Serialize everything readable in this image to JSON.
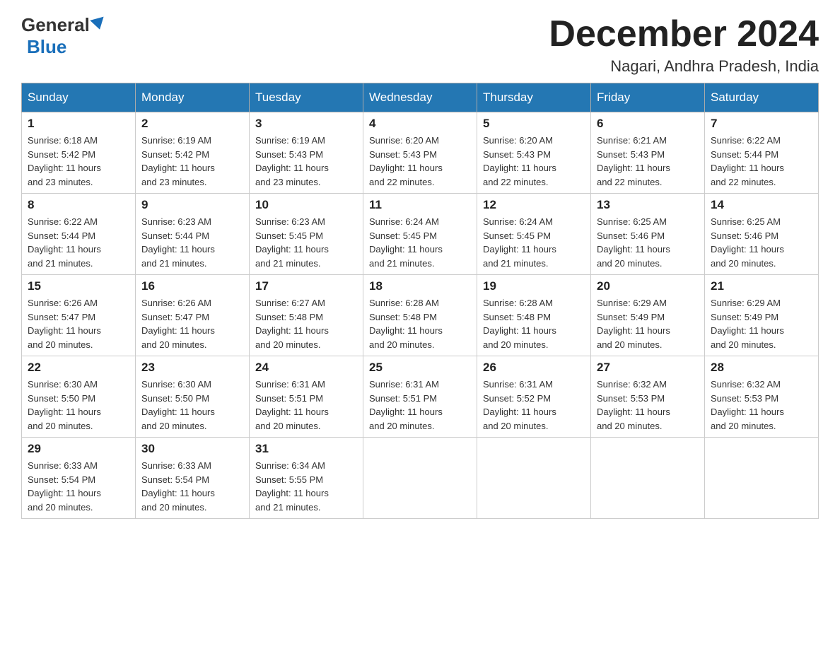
{
  "logo": {
    "general": "General",
    "triangle": "▲",
    "blue": "Blue"
  },
  "title": "December 2024",
  "location": "Nagari, Andhra Pradesh, India",
  "weekdays": [
    "Sunday",
    "Monday",
    "Tuesday",
    "Wednesday",
    "Thursday",
    "Friday",
    "Saturday"
  ],
  "weeks": [
    [
      {
        "day": "1",
        "sunrise": "6:18 AM",
        "sunset": "5:42 PM",
        "daylight": "11 hours and 23 minutes."
      },
      {
        "day": "2",
        "sunrise": "6:19 AM",
        "sunset": "5:42 PM",
        "daylight": "11 hours and 23 minutes."
      },
      {
        "day": "3",
        "sunrise": "6:19 AM",
        "sunset": "5:43 PM",
        "daylight": "11 hours and 23 minutes."
      },
      {
        "day": "4",
        "sunrise": "6:20 AM",
        "sunset": "5:43 PM",
        "daylight": "11 hours and 22 minutes."
      },
      {
        "day": "5",
        "sunrise": "6:20 AM",
        "sunset": "5:43 PM",
        "daylight": "11 hours and 22 minutes."
      },
      {
        "day": "6",
        "sunrise": "6:21 AM",
        "sunset": "5:43 PM",
        "daylight": "11 hours and 22 minutes."
      },
      {
        "day": "7",
        "sunrise": "6:22 AM",
        "sunset": "5:44 PM",
        "daylight": "11 hours and 22 minutes."
      }
    ],
    [
      {
        "day": "8",
        "sunrise": "6:22 AM",
        "sunset": "5:44 PM",
        "daylight": "11 hours and 21 minutes."
      },
      {
        "day": "9",
        "sunrise": "6:23 AM",
        "sunset": "5:44 PM",
        "daylight": "11 hours and 21 minutes."
      },
      {
        "day": "10",
        "sunrise": "6:23 AM",
        "sunset": "5:45 PM",
        "daylight": "11 hours and 21 minutes."
      },
      {
        "day": "11",
        "sunrise": "6:24 AM",
        "sunset": "5:45 PM",
        "daylight": "11 hours and 21 minutes."
      },
      {
        "day": "12",
        "sunrise": "6:24 AM",
        "sunset": "5:45 PM",
        "daylight": "11 hours and 21 minutes."
      },
      {
        "day": "13",
        "sunrise": "6:25 AM",
        "sunset": "5:46 PM",
        "daylight": "11 hours and 20 minutes."
      },
      {
        "day": "14",
        "sunrise": "6:25 AM",
        "sunset": "5:46 PM",
        "daylight": "11 hours and 20 minutes."
      }
    ],
    [
      {
        "day": "15",
        "sunrise": "6:26 AM",
        "sunset": "5:47 PM",
        "daylight": "11 hours and 20 minutes."
      },
      {
        "day": "16",
        "sunrise": "6:26 AM",
        "sunset": "5:47 PM",
        "daylight": "11 hours and 20 minutes."
      },
      {
        "day": "17",
        "sunrise": "6:27 AM",
        "sunset": "5:48 PM",
        "daylight": "11 hours and 20 minutes."
      },
      {
        "day": "18",
        "sunrise": "6:28 AM",
        "sunset": "5:48 PM",
        "daylight": "11 hours and 20 minutes."
      },
      {
        "day": "19",
        "sunrise": "6:28 AM",
        "sunset": "5:48 PM",
        "daylight": "11 hours and 20 minutes."
      },
      {
        "day": "20",
        "sunrise": "6:29 AM",
        "sunset": "5:49 PM",
        "daylight": "11 hours and 20 minutes."
      },
      {
        "day": "21",
        "sunrise": "6:29 AM",
        "sunset": "5:49 PM",
        "daylight": "11 hours and 20 minutes."
      }
    ],
    [
      {
        "day": "22",
        "sunrise": "6:30 AM",
        "sunset": "5:50 PM",
        "daylight": "11 hours and 20 minutes."
      },
      {
        "day": "23",
        "sunrise": "6:30 AM",
        "sunset": "5:50 PM",
        "daylight": "11 hours and 20 minutes."
      },
      {
        "day": "24",
        "sunrise": "6:31 AM",
        "sunset": "5:51 PM",
        "daylight": "11 hours and 20 minutes."
      },
      {
        "day": "25",
        "sunrise": "6:31 AM",
        "sunset": "5:51 PM",
        "daylight": "11 hours and 20 minutes."
      },
      {
        "day": "26",
        "sunrise": "6:31 AM",
        "sunset": "5:52 PM",
        "daylight": "11 hours and 20 minutes."
      },
      {
        "day": "27",
        "sunrise": "6:32 AM",
        "sunset": "5:53 PM",
        "daylight": "11 hours and 20 minutes."
      },
      {
        "day": "28",
        "sunrise": "6:32 AM",
        "sunset": "5:53 PM",
        "daylight": "11 hours and 20 minutes."
      }
    ],
    [
      {
        "day": "29",
        "sunrise": "6:33 AM",
        "sunset": "5:54 PM",
        "daylight": "11 hours and 20 minutes."
      },
      {
        "day": "30",
        "sunrise": "6:33 AM",
        "sunset": "5:54 PM",
        "daylight": "11 hours and 20 minutes."
      },
      {
        "day": "31",
        "sunrise": "6:34 AM",
        "sunset": "5:55 PM",
        "daylight": "11 hours and 21 minutes."
      },
      null,
      null,
      null,
      null
    ]
  ],
  "labels": {
    "sunrise": "Sunrise:",
    "sunset": "Sunset:",
    "daylight": "Daylight:"
  }
}
